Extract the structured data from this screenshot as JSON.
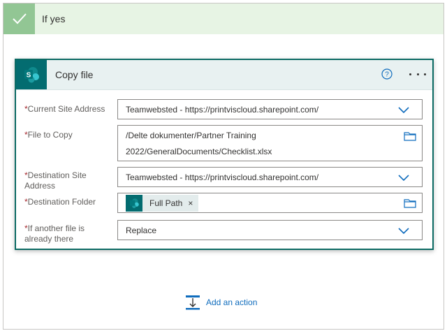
{
  "branch": {
    "title": "If yes",
    "accent": "#92c694",
    "header_bg": "#e7f4e4"
  },
  "card": {
    "title": "Copy file",
    "brand_color": "#036c70",
    "icons": {
      "connector": "sharepoint-icon",
      "help": "help-icon",
      "menu": "more-options-icon"
    }
  },
  "fields": {
    "current_site": {
      "required_mark": "*",
      "label": "Current Site Address",
      "value": "Teamwebsted - https://printviscloud.sharepoint.com/"
    },
    "file_to_copy": {
      "required_mark": "*",
      "label": "File to Copy",
      "value_line1": "/Delte dokumenter/Partner Training",
      "value_line2": "2022/GeneralDocuments/Checklist.xlsx"
    },
    "destination_site": {
      "required_mark": "*",
      "label_line1": "Destination Site",
      "label_line2": "Address",
      "value": "Teamwebsted - https://printviscloud.sharepoint.com/"
    },
    "destination_folder": {
      "required_mark": "*",
      "label": "Destination Folder",
      "token_label": "Full Path",
      "token_close": "×"
    },
    "if_exists": {
      "required_mark": "*",
      "label_line1": "If another file is",
      "label_line2": "already there",
      "value": "Replace"
    }
  },
  "footer": {
    "add_action_label": "Add an action",
    "link_color": "#0f6cbd"
  }
}
